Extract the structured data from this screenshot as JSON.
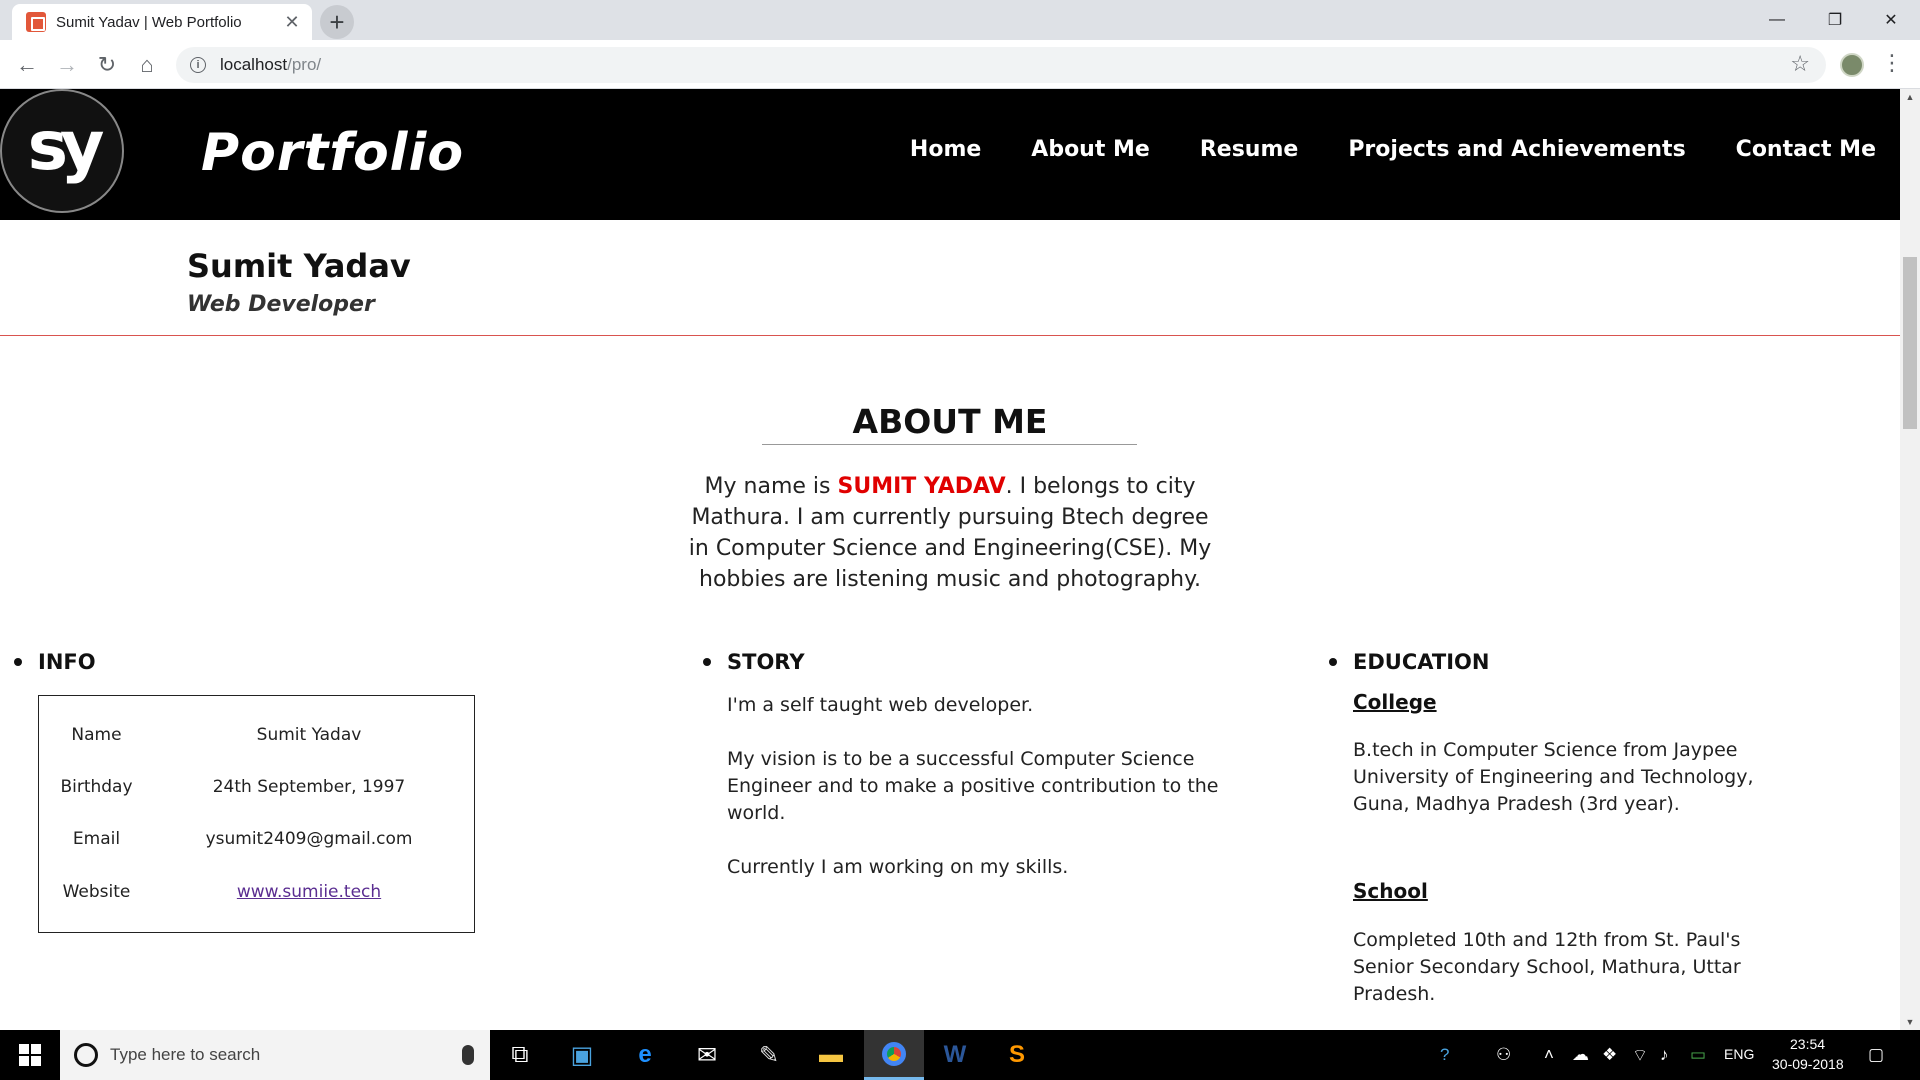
{
  "browser": {
    "tab_title": "Sumit Yadav | Web Portfolio",
    "tab_close": "✕",
    "new_tab": "+",
    "url_host": "localhost",
    "url_path": "/pro/",
    "window_controls": {
      "minimize": "—",
      "restore": "❐",
      "close": "✕"
    }
  },
  "site": {
    "logo_text": "sy",
    "brand": "Portfolio",
    "nav": [
      "Home",
      "About Me",
      "Resume",
      "Projects and Achievements",
      "Contact Me"
    ]
  },
  "person": {
    "name": "Sumit Yadav",
    "role": "Web Developer"
  },
  "about": {
    "title": "ABOUT ME",
    "text_before": "My name is ",
    "highlight": "SUMIT YADAV",
    "text_after": ". I belongs to city Mathura. I am currently pursuing Btech degree in Computer Science and Engineering(CSE). My hobbies are listening music and photography.",
    "highlight_color": "#e00000"
  },
  "info": {
    "heading": "INFO",
    "rows": [
      {
        "label": "Name",
        "value": "Sumit Yadav"
      },
      {
        "label": "Birthday",
        "value": "24th September, 1997"
      },
      {
        "label": "Email",
        "value": "ysumit2409@gmail.com"
      },
      {
        "label": "Website",
        "value": "www.sumiie.tech"
      }
    ]
  },
  "story": {
    "heading": "STORY",
    "paragraphs": [
      "I'm a self taught web developer.",
      "My vision is to be a successful Computer Science Engineer and to make a positive contribution to the world.",
      "Currently I am working on my skills."
    ]
  },
  "education": {
    "heading": "EDUCATION",
    "college_label": "College",
    "college_text": "B.tech in Computer Science from Jaypee University of Engineering and Technology, Guna, Madhya Pradesh (3rd year).",
    "school_label": "School",
    "school_text": "Completed 10th and 12th from St. Paul's Senior Secondary School, Mathura, Uttar Pradesh."
  },
  "taskbar": {
    "search_placeholder": "Type here to search",
    "language": "ENG",
    "time": "23:54",
    "date": "30-09-2018"
  }
}
